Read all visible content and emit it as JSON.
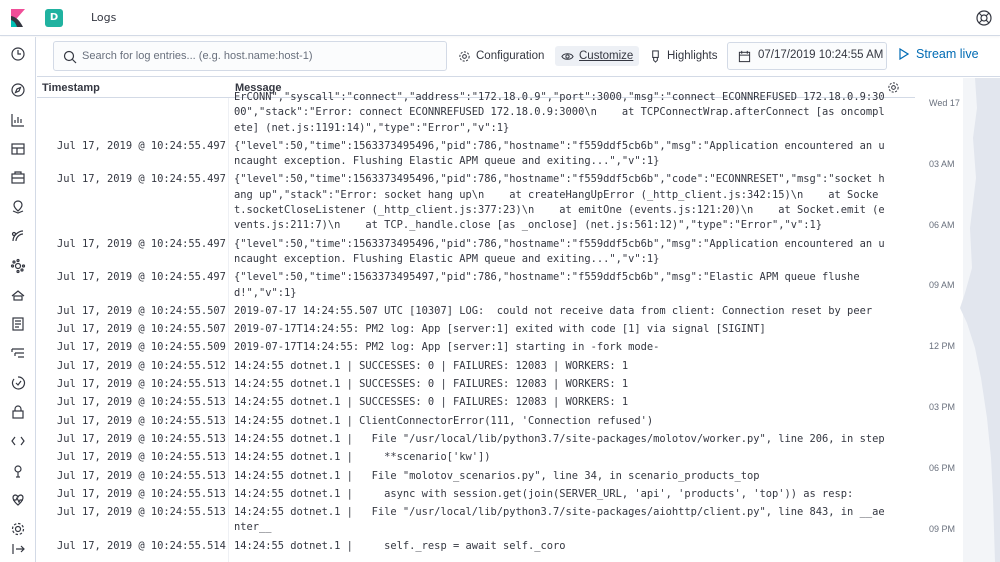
{
  "app": {
    "title": "Logs",
    "space_initial": "D"
  },
  "search": {
    "placeholder": "Search for log entries... (e.g. host.name:host-1)",
    "value": ""
  },
  "toolbar": {
    "configuration_label": "Configuration",
    "customize_label": "Customize",
    "highlights_label": "Highlights",
    "date_value": "07/17/2019 10:24:55 AM",
    "stream_label": "Stream live"
  },
  "table": {
    "timestamp_header": "Timestamp",
    "message_header": "Message"
  },
  "rows": [
    {
      "ts": "",
      "msg": "ErCONN\",\"syscall\":\"connect\",\"address\":\"172.18.0.9\",\"port\":3000,\"msg\":\"connect ECONNREFUSED 172.18.0.9:3000\",\"stack\":\"Error: connect ECONNREFUSED 172.18.0.9:3000\\n    at TCPConnectWrap.afterConnect [as oncomplete] (net.js:1191:14)\",\"type\":\"Error\",\"v\":1}"
    },
    {
      "ts": "Jul 17, 2019 @ 10:24:55.497",
      "msg": "{\"level\":50,\"time\":1563373495496,\"pid\":786,\"hostname\":\"f559ddf5cb6b\",\"msg\":\"Application encountered an uncaught exception. Flushing Elastic APM queue and exiting...\",\"v\":1}"
    },
    {
      "ts": "Jul 17, 2019 @ 10:24:55.497",
      "msg": "{\"level\":50,\"time\":1563373495496,\"pid\":786,\"hostname\":\"f559ddf5cb6b\",\"code\":\"ECONNRESET\",\"msg\":\"socket hang up\",\"stack\":\"Error: socket hang up\\n    at createHangUpError (_http_client.js:342:15)\\n    at Socket.socketCloseListener (_http_client.js:377:23)\\n    at emitOne (events.js:121:20)\\n    at Socket.emit (events.js:211:7)\\n    at TCP._handle.close [as _onclose] (net.js:561:12)\",\"type\":\"Error\",\"v\":1}"
    },
    {
      "ts": "Jul 17, 2019 @ 10:24:55.497",
      "msg": "{\"level\":50,\"time\":1563373495496,\"pid\":786,\"hostname\":\"f559ddf5cb6b\",\"msg\":\"Application encountered an uncaught exception. Flushing Elastic APM queue and exiting...\",\"v\":1}"
    },
    {
      "ts": "Jul 17, 2019 @ 10:24:55.497",
      "msg": "{\"level\":50,\"time\":1563373495497,\"pid\":786,\"hostname\":\"f559ddf5cb6b\",\"msg\":\"Elastic APM queue flushed!\",\"v\":1}"
    },
    {
      "ts": "Jul 17, 2019 @ 10:24:55.507",
      "msg": "2019-07-17 14:24:55.507 UTC [10307] LOG:  could not receive data from client: Connection reset by peer"
    },
    {
      "ts": "Jul 17, 2019 @ 10:24:55.507",
      "msg": "2019-07-17T14:24:55: PM2 log: App [server:1] exited with code [1] via signal [SIGINT]"
    },
    {
      "ts": "Jul 17, 2019 @ 10:24:55.509",
      "msg": "2019-07-17T14:24:55: PM2 log: App [server:1] starting in -fork mode-"
    },
    {
      "ts": "Jul 17, 2019 @ 10:24:55.512",
      "msg": "14:24:55 dotnet.1 | SUCCESSES: 0 | FAILURES: 12083 | WORKERS: 1"
    },
    {
      "ts": "Jul 17, 2019 @ 10:24:55.513",
      "msg": "14:24:55 dotnet.1 | SUCCESSES: 0 | FAILURES: 12083 | WORKERS: 1"
    },
    {
      "ts": "Jul 17, 2019 @ 10:24:55.513",
      "msg": "14:24:55 dotnet.1 | SUCCESSES: 0 | FAILURES: 12083 | WORKERS: 1"
    },
    {
      "ts": "Jul 17, 2019 @ 10:24:55.513",
      "msg": "14:24:55 dotnet.1 | ClientConnectorError(111, 'Connection refused')"
    },
    {
      "ts": "Jul 17, 2019 @ 10:24:55.513",
      "msg": "14:24:55 dotnet.1 |   File \"/usr/local/lib/python3.7/site-packages/molotov/worker.py\", line 206, in step"
    },
    {
      "ts": "Jul 17, 2019 @ 10:24:55.513",
      "msg": "14:24:55 dotnet.1 |     **scenario['kw'])"
    },
    {
      "ts": "Jul 17, 2019 @ 10:24:55.513",
      "msg": "14:24:55 dotnet.1 |   File \"molotov_scenarios.py\", line 34, in scenario_products_top"
    },
    {
      "ts": "Jul 17, 2019 @ 10:24:55.513",
      "msg": "14:24:55 dotnet.1 |     async with session.get(join(SERVER_URL, 'api', 'products', 'top')) as resp:"
    },
    {
      "ts": "Jul 17, 2019 @ 10:24:55.513",
      "msg": "14:24:55 dotnet.1 |   File \"/usr/local/lib/python3.7/site-packages/aiohttp/client.py\", line 843, in __aenter__"
    },
    {
      "ts": "Jul 17, 2019 @ 10:24:55.514",
      "msg": "14:24:55 dotnet.1 |     self._resp = await self._coro"
    }
  ],
  "minimap": {
    "labels": [
      "Wed 17",
      "03 AM",
      "06 AM",
      "09 AM",
      "12 PM",
      "03 PM",
      "06 PM",
      "09 PM"
    ]
  },
  "nav_icons": [
    "clock-icon",
    "compass-icon",
    "visualize-icon",
    "dashboard-icon",
    "canvas-icon",
    "maps-icon",
    "machine-learning-icon",
    "infrastructure-icon",
    "siem-icon",
    "logs-icon",
    "apm-icon",
    "uptime-icon",
    "security-icon",
    "dev-tools-icon",
    "monitoring-icon",
    "heartbeat-icon",
    "management-icon",
    "collapse-icon"
  ],
  "colors": {
    "accent": "#006bb4",
    "space_badge": "#20b2a0",
    "border": "#d3dae6"
  }
}
